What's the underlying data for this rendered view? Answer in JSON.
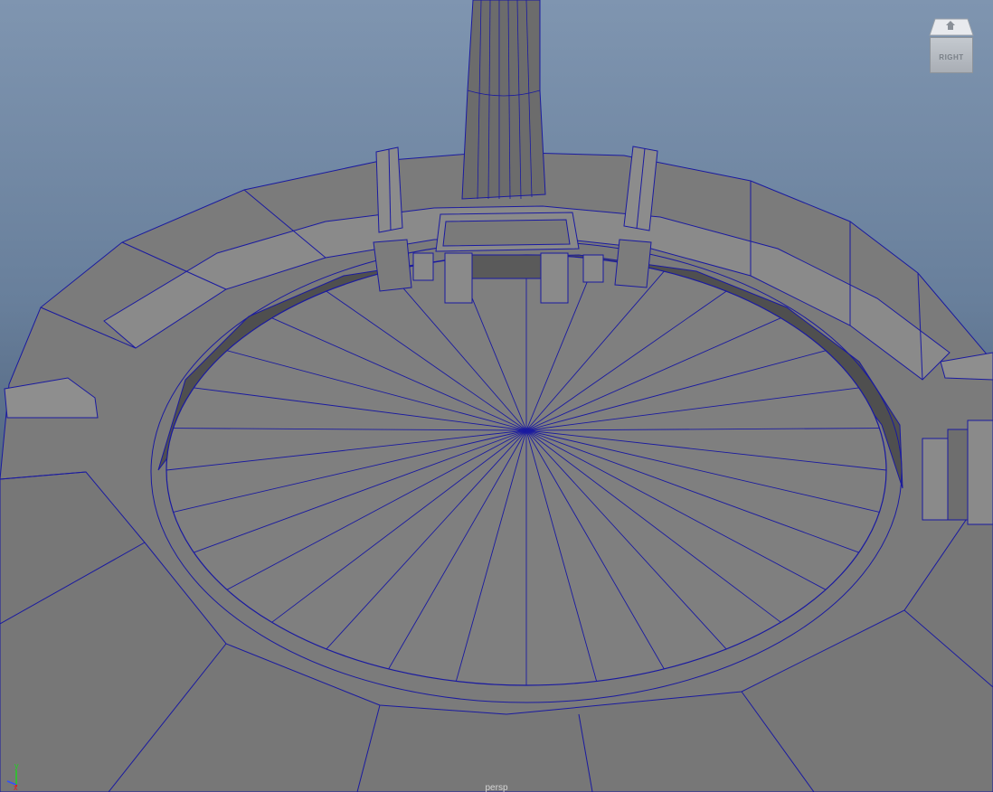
{
  "viewport": {
    "camera_name": "persp",
    "background_top": "#7f95b0",
    "background_bottom": "#1f2733",
    "wireframe_color": "#1a1aa0",
    "surface_color": "#7a7a7a"
  },
  "viewcube": {
    "face_label": "RIGHT",
    "icon": "house-icon"
  },
  "axis_indicator": {
    "x_label": "x",
    "y_label": "y",
    "x_color": "#e02020",
    "y_color": "#20d020",
    "z_color": "#3050ff"
  },
  "scene": {
    "object": "arena-model",
    "floor_segments": 32
  }
}
